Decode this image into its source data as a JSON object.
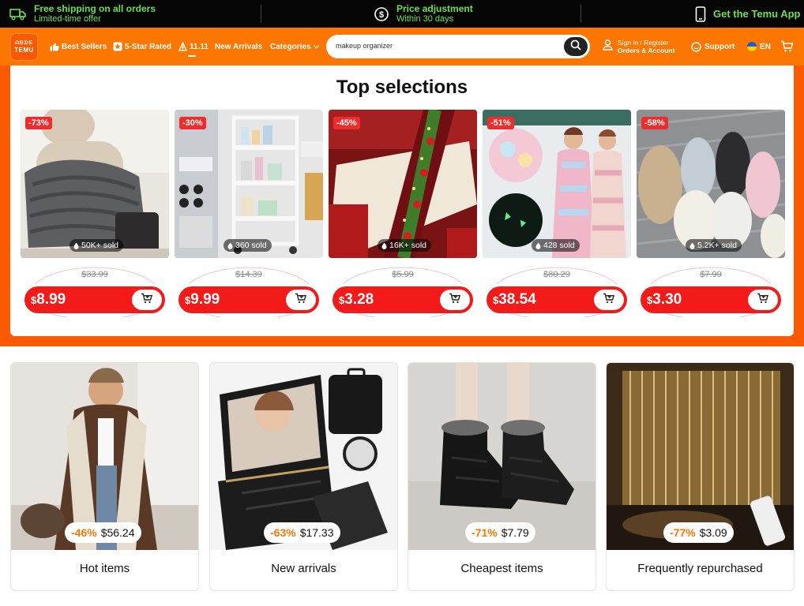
{
  "promo_bar": {
    "shipping_title": "Free shipping on all orders",
    "shipping_sub": "Limited-time offer",
    "price_title": "Price adjustment",
    "price_sub": "Within 30 days",
    "app_label": "Get the Temu App",
    "accent_color": "#6be04b"
  },
  "header": {
    "logo_top": "ᗩᗷᗪᗴ",
    "logo_text": "TEMU",
    "nav": {
      "best_sellers": "Best Sellers",
      "five_star": "5-Star Rated",
      "eleven": "11.11",
      "new_arrivals": "New Arrivals",
      "categories": "Categories"
    },
    "search_value": "makeup organizer",
    "account_line1": "Sign in / Register",
    "account_line2": "Orders & Account",
    "support": "Support",
    "language": "EN",
    "brand_color": "#fb7701"
  },
  "top_selections": {
    "title": "Top selections",
    "products": [
      {
        "discount": "-73%",
        "sold": "50K+ sold",
        "original_price": "$33.99",
        "currency": "$",
        "price": "8.99",
        "image": "grey-knit-blanket"
      },
      {
        "discount": "-30%",
        "sold": "360 sold",
        "original_price": "$14.39",
        "currency": "$",
        "price": "9.99",
        "image": "rolling-storage-cart"
      },
      {
        "discount": "-45%",
        "sold": "16K+ sold",
        "original_price": "$5.99",
        "currency": "$",
        "price": "3.28",
        "image": "christmas-table-runner"
      },
      {
        "discount": "-51%",
        "sold": "428 sold",
        "original_price": "$80.29",
        "currency": "$",
        "price": "38.54",
        "image": "fleece-robes"
      },
      {
        "discount": "-58%",
        "sold": "5.2K+ sold",
        "original_price": "$7.99",
        "currency": "$",
        "price": "3.30",
        "image": "fuzzy-mittens"
      }
    ]
  },
  "categories": [
    {
      "label": "Hot items",
      "discount": "-46%",
      "price": "$56.24",
      "image": "woman-in-long-coat"
    },
    {
      "label": "New arrivals",
      "discount": "-63%",
      "price": "$17.33",
      "image": "led-makeup-case"
    },
    {
      "label": "Cheapest items",
      "discount": "-71%",
      "price": "$7.79",
      "image": "black-snow-boots"
    },
    {
      "label": "Frequently repurchased",
      "discount": "-77%",
      "price": "$3.09",
      "image": "curtain-string-lights"
    }
  ]
}
